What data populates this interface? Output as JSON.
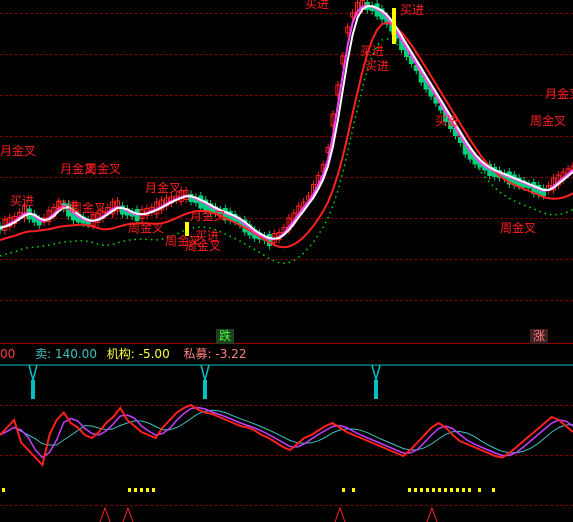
{
  "colors": {
    "background": "#000000",
    "grid": "#7a0000",
    "signal_red": "#ff2020",
    "up_candle": "#ff2020",
    "down_candle": "#00d080",
    "ma_white": "#ffffff",
    "ma_magenta": "#ff40ff",
    "ma_red": "#ff2020",
    "dots_green": "#00e000",
    "osc_red": "#ff2020",
    "osc_purple": "#c040ff",
    "osc_cyan": "#40c0c0",
    "cyan_marker": "#00c0c0",
    "yellow_marker": "#ffff00",
    "label_yellow": "#ffff40",
    "label_teal": "#40c0c0",
    "label_pink": "#ff8080"
  },
  "header": {
    "lead": "00",
    "sell_label": "卖: 140.00",
    "institution_label": "机构: -5.00",
    "private_label": "私募: -3.22"
  },
  "badges": {
    "down_text": "跌",
    "up_text": "涨"
  },
  "signals": {
    "monthly_cross": "月金叉",
    "weekly_cross": "周金叉",
    "buy": "买进",
    "buy_short": "买进"
  },
  "chart_data": [
    {
      "type": "candlestick",
      "title": "",
      "series": [
        {
          "name": "",
          "values": [
            228,
            225,
            222,
            220,
            215,
            212,
            214,
            218,
            222,
            220,
            216,
            212,
            205,
            206,
            210,
            215,
            218,
            220,
            222,
            220,
            218,
            215,
            210,
            208,
            206,
            210,
            212,
            214,
            215,
            214,
            212,
            210,
            208,
            205,
            202,
            200,
            198,
            196,
            195,
            198,
            200,
            202,
            205,
            208,
            210,
            212,
            214,
            216,
            218,
            222,
            226,
            230,
            234,
            236,
            238,
            240,
            238,
            236,
            230,
            224,
            218,
            210,
            205,
            198,
            190,
            180,
            168,
            150,
            120,
            90,
            60,
            30,
            15,
            8,
            5,
            6,
            8,
            10,
            14,
            20,
            28,
            36,
            44,
            52,
            60,
            68,
            76,
            84,
            92,
            100,
            108,
            116,
            124,
            132,
            140,
            148,
            154,
            160,
            164,
            168,
            170,
            172,
            174,
            176,
            178,
            180,
            182,
            184,
            186,
            188,
            190,
            192,
            188,
            184,
            180,
            176,
            172,
            168
          ]
        }
      ]
    },
    {
      "type": "line",
      "title": "",
      "series": [
        {
          "name": "",
          "values": [
            30,
            35,
            40,
            25,
            20,
            15,
            10,
            30,
            40,
            45,
            38,
            35,
            30,
            28,
            32,
            38,
            42,
            48,
            40,
            36,
            32,
            30,
            28,
            35,
            40,
            45,
            48,
            50,
            47,
            45,
            44,
            42,
            40,
            38,
            36,
            35,
            33,
            30,
            28,
            25,
            22,
            20,
            24,
            28,
            30,
            33,
            36,
            38,
            35,
            32,
            30,
            28,
            26,
            24,
            22,
            20,
            18,
            16,
            20,
            25,
            30,
            35,
            38,
            35,
            30,
            26,
            24,
            22,
            20,
            18,
            16,
            15,
            18,
            22,
            26,
            30,
            34,
            38,
            42,
            40,
            36,
            32
          ]
        }
      ]
    }
  ]
}
